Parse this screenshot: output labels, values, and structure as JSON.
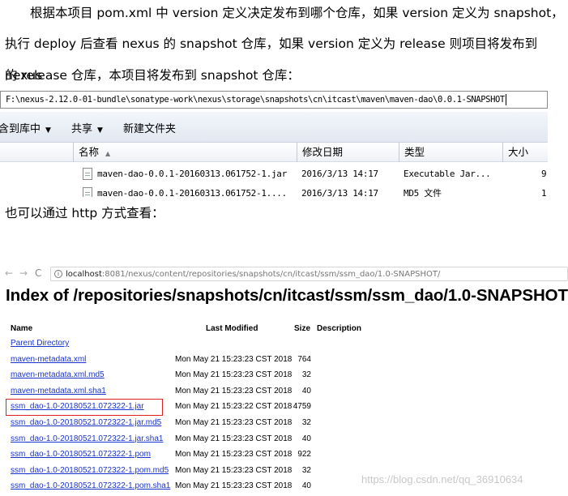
{
  "paragraphs": {
    "p1_line1": "根据本项目 pom.xml 中 version 定义决定发布到哪个仓库，如果 version 定义为 snapshot，",
    "p1_line2": "执行 deploy 后查看 nexus 的 snapshot 仓库，如果 version 定义为 release 则项目将发布到 nexus",
    "p1_line3": "的 release 仓库，本项目将发布到 snapshot 仓库：",
    "p2": "也可以通过 http 方式查看："
  },
  "explorer": {
    "address": "F:\\nexus-2.12.0-01-bundle\\sonatype-work\\nexus\\storage\\snapshots\\cn\\itcast\\maven\\maven-dao\\0.0.1-SNAPSHOT",
    "toolbar": {
      "include_in_library": "含到库中",
      "share": "共享",
      "new_folder": "新建文件夹",
      "dropdown_glyph": "▼"
    },
    "columns": {
      "name": "名称",
      "modified": "修改日期",
      "type": "类型",
      "size": "大小",
      "sort_glyph": "▲"
    },
    "files": [
      {
        "name": "maven-dao-0.0.1-20160313.061752-1.jar",
        "modified": "2016/3/13 14:17",
        "type": "Executable Jar...",
        "size": "9"
      },
      {
        "name": "maven-dao-0.0.1-20160313.061752-1....",
        "modified": "2016/3/13 14:17",
        "type": "MD5 文件",
        "size": "1"
      }
    ]
  },
  "browser": {
    "nav": {
      "back": "←",
      "forward": "→",
      "reload": "C",
      "info": "i"
    },
    "url_host": "localhost",
    "url_path": ":8081/nexus/content/repositories/snapshots/cn/itcast/ssm/ssm_dao/1.0-SNAPSHOT/",
    "title": "Index of /repositories/snapshots/cn/itcast/ssm/ssm_dao/1.0-SNAPSHOT",
    "columns": {
      "name": "Name",
      "modified": "Last Modified",
      "size": "Size",
      "description": "Description"
    },
    "parent_link": "Parent Directory",
    "rows": [
      {
        "name": "maven-metadata.xml",
        "modified": "Mon May 21 15:23:23 CST 2018",
        "size": "764"
      },
      {
        "name": "maven-metadata.xml.md5",
        "modified": "Mon May 21 15:23:23 CST 2018",
        "size": "32"
      },
      {
        "name": "maven-metadata.xml.sha1",
        "modified": "Mon May 21 15:23:23 CST 2018",
        "size": "40"
      },
      {
        "name": "ssm_dao-1.0-20180521.072322-1.jar",
        "modified": "Mon May 21 15:23:22 CST 2018",
        "size": "4759"
      },
      {
        "name": "ssm_dao-1.0-20180521.072322-1.jar.md5",
        "modified": "Mon May 21 15:23:23 CST 2018",
        "size": "32"
      },
      {
        "name": "ssm_dao-1.0-20180521.072322-1.jar.sha1",
        "modified": "Mon May 21 15:23:23 CST 2018",
        "size": "40"
      },
      {
        "name": "ssm_dao-1.0-20180521.072322-1.pom",
        "modified": "Mon May 21 15:23:23 CST 2018",
        "size": "922"
      },
      {
        "name": "ssm_dao-1.0-20180521.072322-1.pom.md5",
        "modified": "Mon May 21 15:23:23 CST 2018",
        "size": "32"
      },
      {
        "name": "ssm_dao-1.0-20180521.072322-1.pom.sha1",
        "modified": "Mon May 21 15:23:23 CST 2018",
        "size": "40"
      }
    ],
    "highlight_color": "#e02020",
    "watermark": "https://blog.csdn.net/qq_36910634"
  }
}
